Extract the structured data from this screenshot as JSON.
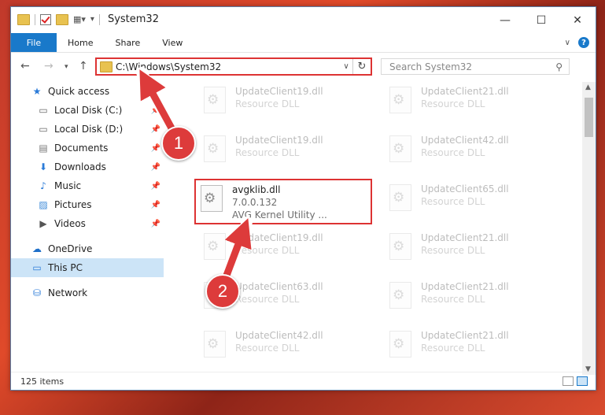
{
  "window": {
    "title": "System32",
    "controls": {
      "minimize": "—",
      "maximize": "☐",
      "close": "✕"
    }
  },
  "ribbon": {
    "tabs": [
      "File",
      "Home",
      "Share",
      "View"
    ]
  },
  "address": {
    "path": "C:\\Windows\\System32",
    "search_placeholder": "Search System32"
  },
  "nav": {
    "items": [
      {
        "label": "Quick access",
        "icon": "star-icon",
        "pinned": false
      },
      {
        "label": "Local Disk (C:)",
        "icon": "drive-icon",
        "pinned": true
      },
      {
        "label": "Local Disk (D:)",
        "icon": "drive-icon",
        "pinned": true
      },
      {
        "label": "Documents",
        "icon": "document-icon",
        "pinned": true
      },
      {
        "label": "Downloads",
        "icon": "download-icon",
        "pinned": true
      },
      {
        "label": "Music",
        "icon": "music-icon",
        "pinned": true
      },
      {
        "label": "Pictures",
        "icon": "picture-icon",
        "pinned": true
      },
      {
        "label": "Videos",
        "icon": "video-icon",
        "pinned": true
      },
      {
        "label": "OneDrive",
        "icon": "cloud-icon",
        "pinned": false
      },
      {
        "label": "This PC",
        "icon": "computer-icon",
        "pinned": false
      },
      {
        "label": "Network",
        "icon": "network-icon",
        "pinned": false
      }
    ]
  },
  "files": {
    "col1": [
      {
        "name": "UpdateClient19.dll",
        "sub": "Resource DLL"
      },
      {
        "name": "UpdateClient19.dll",
        "sub": "Resource DLL"
      },
      {
        "name": "avgklib.dll",
        "sub": "7.0.0.132",
        "sub2": "AVG Kernel Utility ..."
      },
      {
        "name": "UpdateClient19.dll",
        "sub": "Resource DLL"
      },
      {
        "name": "UpdateClient63.dll",
        "sub": "Resource DLL"
      },
      {
        "name": "UpdateClient42.dll",
        "sub": "Resource DLL"
      }
    ],
    "col2": [
      {
        "name": "UpdateClient21.dll",
        "sub": "Resource DLL"
      },
      {
        "name": "UpdateClient42.dll",
        "sub": "Resource DLL"
      },
      {
        "name": "UpdateClient65.dll",
        "sub": "Resource DLL"
      },
      {
        "name": "UpdateClient21.dll",
        "sub": "Resource DLL"
      },
      {
        "name": "UpdateClient21.dll",
        "sub": "Resource DLL"
      },
      {
        "name": "UpdateClient21.dll",
        "sub": "Resource DLL"
      }
    ]
  },
  "status": {
    "count": "125 items"
  },
  "annotations": {
    "badge1": "1",
    "badge2": "2",
    "color": "#dd3b3b"
  }
}
